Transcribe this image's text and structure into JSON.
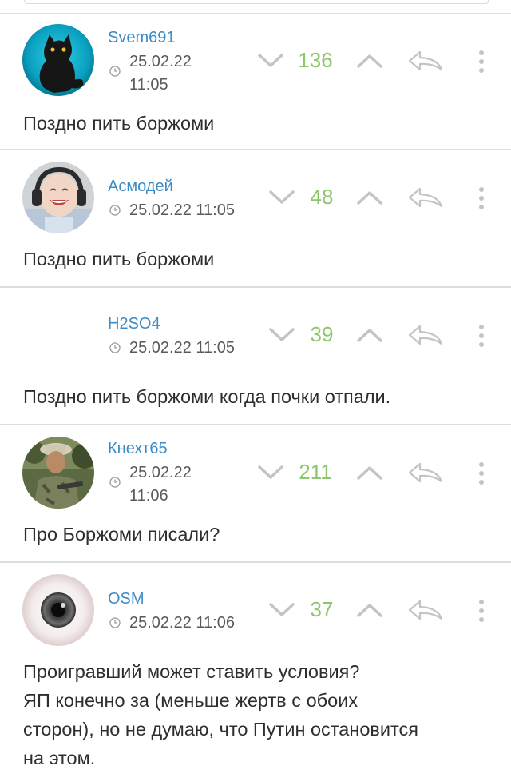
{
  "comments": [
    {
      "author": "Svem691",
      "date": "25.02.22",
      "time": "11:05",
      "score": "136",
      "text": "Поздно пить боржоми",
      "avatar": "cat-avatar"
    },
    {
      "author": "Асмодей",
      "datetime": "25.02.22 11:05",
      "score": "48",
      "text": "Поздно пить боржоми",
      "avatar": "baby-headphones-avatar"
    },
    {
      "author": "H2SO4",
      "datetime": "25.02.22 11:05",
      "score": "39",
      "text": "Поздно пить боржоми когда почки отпали."
    },
    {
      "author": "Кнехт65",
      "date": "25.02.22",
      "time": "11:06",
      "score": "211",
      "text": "Про Боржоми писали?",
      "avatar": "soldier-avatar"
    },
    {
      "author": "OSM",
      "datetime": "25.02.22 11:06",
      "score": "37",
      "text_lines": [
        "Проигравший может ставить условия?",
        "ЯП конечно за (меньше жертв с обоих",
        "сторон), но не думаю, что Путин остановится",
        "на этом."
      ],
      "avatar": "eye-avatar"
    }
  ],
  "icons": {
    "vote_down": "chevron-down-icon",
    "vote_up": "chevron-up-icon",
    "reply": "reply-arrow-icon",
    "more": "more-vertical-icon",
    "clock": "clock-icon"
  },
  "colors": {
    "username": "#3b8cc4",
    "score": "#8dc66b",
    "icon_gray": "#c4c4c4",
    "divider": "#dedede"
  }
}
